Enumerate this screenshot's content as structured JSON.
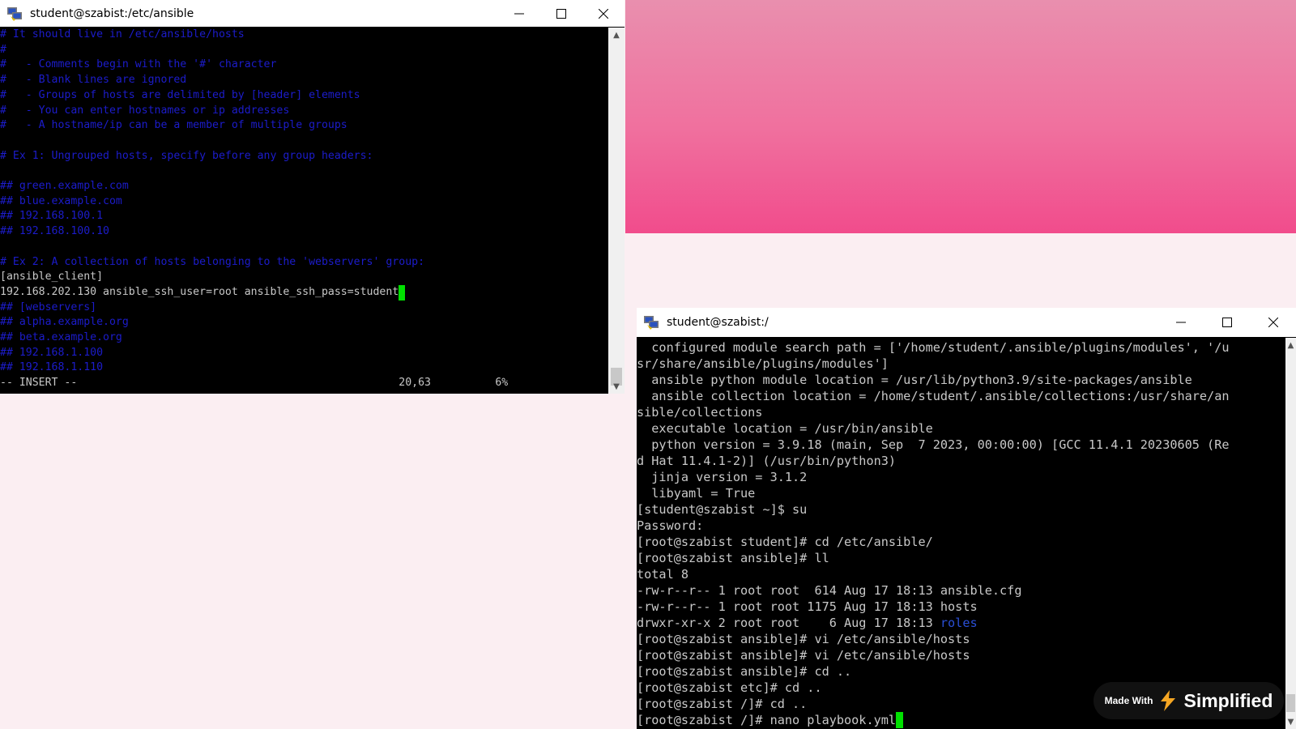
{
  "window1": {
    "title": "student@szabist:/etc/ansible",
    "lines": [
      {
        "text": "# It should live in /etc/ansible/hosts",
        "kind": "comment"
      },
      {
        "text": "#",
        "kind": "comment"
      },
      {
        "text": "#   - Comments begin with the '#' character",
        "kind": "comment"
      },
      {
        "text": "#   - Blank lines are ignored",
        "kind": "comment"
      },
      {
        "text": "#   - Groups of hosts are delimited by [header] elements",
        "kind": "comment"
      },
      {
        "text": "#   - You can enter hostnames or ip addresses",
        "kind": "comment"
      },
      {
        "text": "#   - A hostname/ip can be a member of multiple groups",
        "kind": "comment"
      },
      {
        "text": "",
        "kind": "plain"
      },
      {
        "text": "# Ex 1: Ungrouped hosts, specify before any group headers:",
        "kind": "comment"
      },
      {
        "text": "",
        "kind": "plain"
      },
      {
        "text": "## green.example.com",
        "kind": "comment"
      },
      {
        "text": "## blue.example.com",
        "kind": "comment"
      },
      {
        "text": "## 192.168.100.1",
        "kind": "comment"
      },
      {
        "text": "## 192.168.100.10",
        "kind": "comment"
      },
      {
        "text": "",
        "kind": "plain"
      },
      {
        "text": "# Ex 2: A collection of hosts belonging to the 'webservers' group:",
        "kind": "comment"
      },
      {
        "text": "[ansible_client]",
        "kind": "plain"
      },
      {
        "text": "192.168.202.130 ansible_ssh_user=root ansible_ssh_pass=student",
        "kind": "plain",
        "cursor": true
      },
      {
        "text": "## [webservers]",
        "kind": "comment"
      },
      {
        "text": "## alpha.example.org",
        "kind": "comment"
      },
      {
        "text": "## beta.example.org",
        "kind": "comment"
      },
      {
        "text": "## 192.168.1.100",
        "kind": "comment"
      },
      {
        "text": "## 192.168.1.110",
        "kind": "comment"
      },
      {
        "text": "-- INSERT --                                                  20,63          6%",
        "kind": "plain"
      }
    ]
  },
  "window2": {
    "title": "student@szabist:/",
    "lines": [
      {
        "text": "  configured module search path = ['/home/student/.ansible/plugins/modules', '/u",
        "kind": "plain"
      },
      {
        "text": "sr/share/ansible/plugins/modules']",
        "kind": "plain"
      },
      {
        "text": "  ansible python module location = /usr/lib/python3.9/site-packages/ansible",
        "kind": "plain"
      },
      {
        "text": "  ansible collection location = /home/student/.ansible/collections:/usr/share/an",
        "kind": "plain"
      },
      {
        "text": "sible/collections",
        "kind": "plain"
      },
      {
        "text": "  executable location = /usr/bin/ansible",
        "kind": "plain"
      },
      {
        "text": "  python version = 3.9.18 (main, Sep  7 2023, 00:00:00) [GCC 11.4.1 20230605 (Re",
        "kind": "plain"
      },
      {
        "text": "d Hat 11.4.1-2)] (/usr/bin/python3)",
        "kind": "plain"
      },
      {
        "text": "  jinja version = 3.1.2",
        "kind": "plain"
      },
      {
        "text": "  libyaml = True",
        "kind": "plain"
      },
      {
        "text": "[student@szabist ~]$ su",
        "kind": "plain"
      },
      {
        "text": "Password:",
        "kind": "plain"
      },
      {
        "text": "[root@szabist student]# cd /etc/ansible/",
        "kind": "plain"
      },
      {
        "text": "[root@szabist ansible]# ll",
        "kind": "plain"
      },
      {
        "text": "total 8",
        "kind": "plain"
      },
      {
        "text": "-rw-r--r-- 1 root root  614 Aug 17 18:13 ansible.cfg",
        "kind": "plain"
      },
      {
        "text": "-rw-r--r-- 1 root root 1175 Aug 17 18:13 hosts",
        "kind": "plain"
      },
      {
        "text": "drwxr-xr-x 2 root root    6 Aug 17 18:13 ",
        "kind": "plain",
        "dir": "roles"
      },
      {
        "text": "[root@szabist ansible]# vi /etc/ansible/hosts",
        "kind": "plain"
      },
      {
        "text": "[root@szabist ansible]# vi /etc/ansible/hosts",
        "kind": "plain"
      },
      {
        "text": "[root@szabist ansible]# cd ..",
        "kind": "plain"
      },
      {
        "text": "[root@szabist etc]# cd ..",
        "kind": "plain"
      },
      {
        "text": "[root@szabist /]# cd ..",
        "kind": "plain"
      },
      {
        "text": "[root@szabist /]# nano playbook.yml",
        "kind": "plain",
        "cursor": true
      }
    ]
  },
  "badge": {
    "made_with": "Made With",
    "brand": "Simplified"
  },
  "colors": {
    "comment": "#1c1ccb",
    "directory": "#2a4fd6",
    "cursor": "#00e000",
    "banner": "#f0709e"
  }
}
